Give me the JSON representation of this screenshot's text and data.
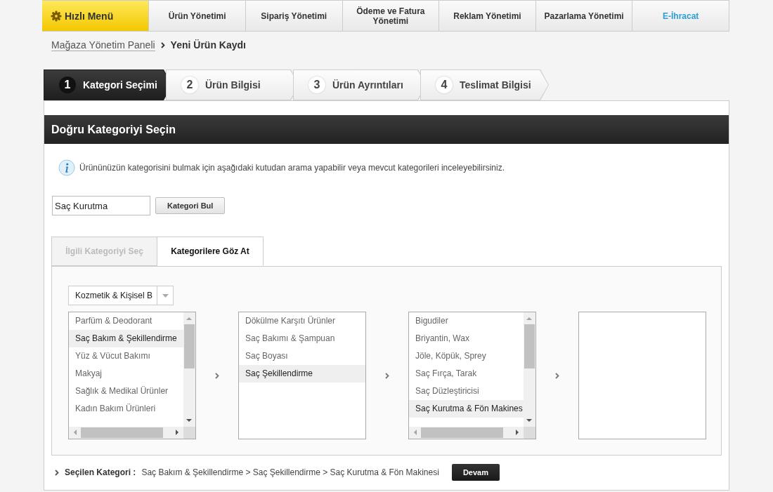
{
  "nav": [
    {
      "label": "Hızlı Menü",
      "kind": "quick"
    },
    {
      "label": "Ürün Yönetimi",
      "kind": "normal"
    },
    {
      "label": "Sipariş Yönetimi",
      "kind": "normal"
    },
    {
      "label": "Ödeme ve Fatura Yönetimi",
      "kind": "normal"
    },
    {
      "label": "Reklam Yönetimi",
      "kind": "normal"
    },
    {
      "label": "Pazarlama Yönetimi",
      "kind": "normal"
    },
    {
      "label": "E-İhracat",
      "kind": "highlight"
    }
  ],
  "breadcrumb": [
    {
      "label": "Mağaza Yönetim Paneli",
      "kind": "link"
    },
    {
      "label": "Yeni Ürün Kaydı",
      "kind": "current"
    }
  ],
  "steps": [
    {
      "number": "1",
      "label": "Kategori Seçimi",
      "selected": true
    },
    {
      "number": "2",
      "label": "Ürün Bilgisi",
      "selected": false
    },
    {
      "number": "3",
      "label": "Ürün Ayrıntıları",
      "selected": false
    },
    {
      "number": "4",
      "label": "Teslimat Bilgisi",
      "selected": false
    }
  ],
  "panel": {
    "title": "Doğru Kategoriyi Seçin",
    "info": "Ürününüzün kategorisini bulmak için aşağıdaki kutudan arama yapabilir veya mevcut kategorileri inceleyebilirsiniz.",
    "search": {
      "value": "Saç Kurutma",
      "button": "Kategori Bul"
    },
    "tabs": [
      {
        "label": "İlgili Kategoriyi Seç",
        "selected": false
      },
      {
        "label": "Kategorilere Göz At",
        "selected": true
      }
    ],
    "dropdown": {
      "value": "Kozmetik & Kişisel B"
    },
    "columns": [
      {
        "scrollable": true,
        "items": [
          {
            "label": "Parfüm & Deodorant",
            "selected": false
          },
          {
            "label": "Saç Bakım & Şekillendirme",
            "selected": true
          },
          {
            "label": "Yüz & Vücut Bakımı",
            "selected": false
          },
          {
            "label": "Makyaj",
            "selected": false
          },
          {
            "label": "Sağlık & Medikal Ürünler",
            "selected": false
          },
          {
            "label": "Kadın Bakım Ürünleri",
            "selected": false
          }
        ]
      },
      {
        "scrollable": false,
        "items": [
          {
            "label": "Dökülme Karşıtı Ürünler",
            "selected": false
          },
          {
            "label": "Saç Bakımı & Şampuan",
            "selected": false
          },
          {
            "label": "Saç Boyası",
            "selected": false
          },
          {
            "label": "Saç Şekillendirme",
            "selected": true
          }
        ]
      },
      {
        "scrollable": true,
        "items": [
          {
            "label": "Bigudiler",
            "selected": false
          },
          {
            "label": "Briyantin, Wax",
            "selected": false
          },
          {
            "label": "Jöle, Köpük, Sprey",
            "selected": false
          },
          {
            "label": "Saç Fırça, Tarak",
            "selected": false
          },
          {
            "label": "Saç Düzleştiricisi",
            "selected": false
          },
          {
            "label": "Saç Kurutma & Fön Makines",
            "selected": true
          }
        ]
      },
      {
        "scrollable": false
      }
    ],
    "selection": {
      "label": "Seçilen Kategori :",
      "path": "Saç Bakım & Şekillendirme > Saç Şekillendirme > Saç Kurutma & Fön Makinesi",
      "button": "Devam"
    }
  }
}
